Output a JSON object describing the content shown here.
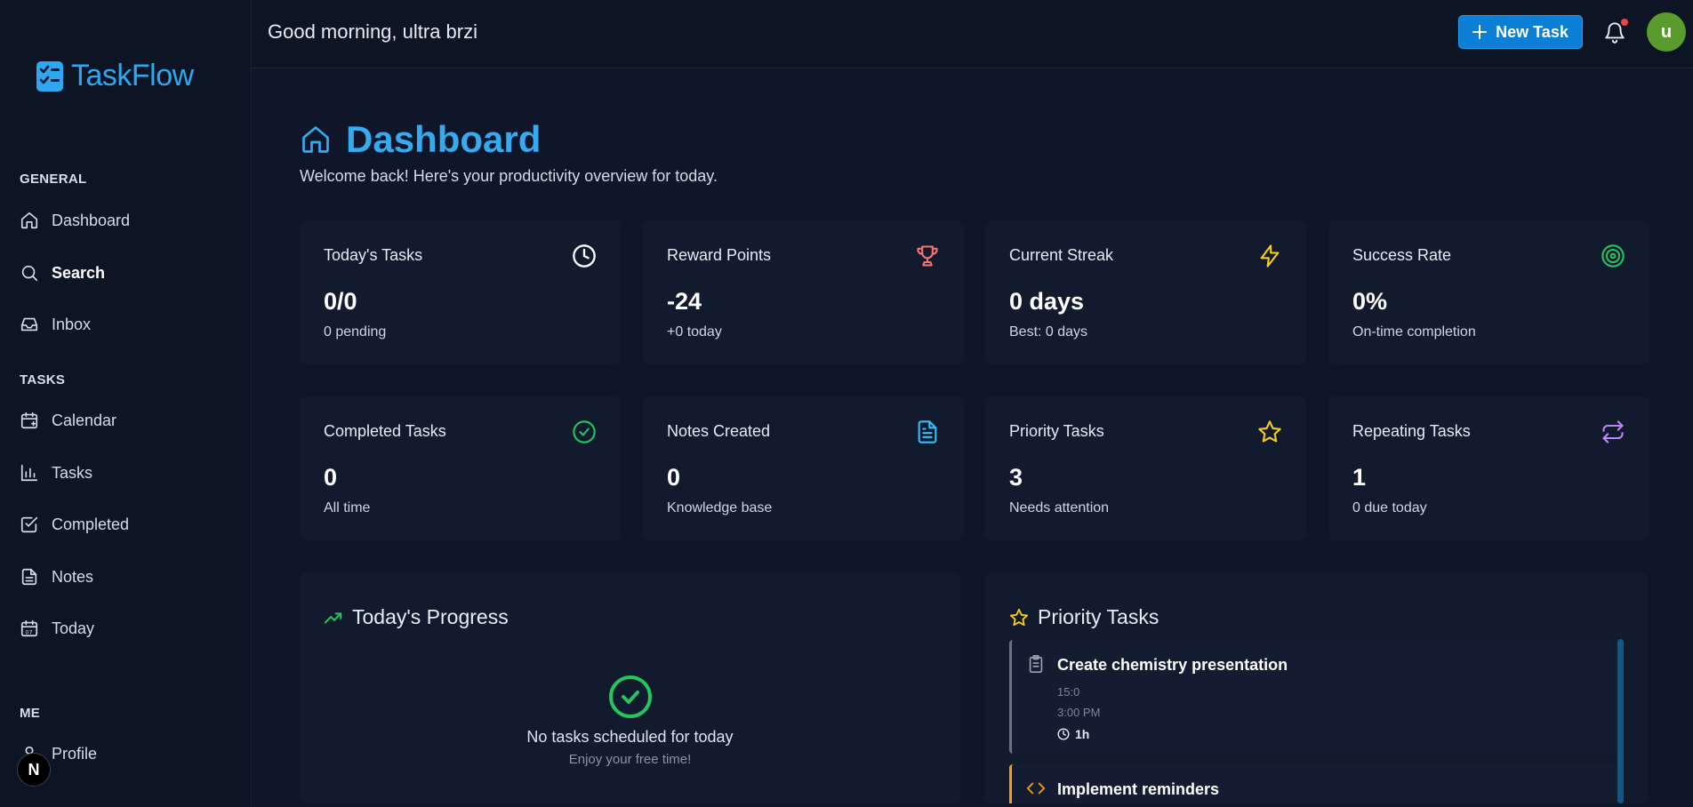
{
  "app": {
    "name": "TaskFlow",
    "accent": "#2ea7f0"
  },
  "header": {
    "greeting": "Good morning, ultra brzi",
    "new_task_label": "New Task",
    "avatar_initial": "u"
  },
  "sidebar": {
    "sections": [
      {
        "title": "GENERAL",
        "items": [
          {
            "label": "Dashboard",
            "icon": "home-icon"
          },
          {
            "label": "Search",
            "icon": "search-icon"
          },
          {
            "label": "Inbox",
            "icon": "inbox-icon"
          }
        ]
      },
      {
        "title": "TASKS",
        "items": [
          {
            "label": "Calendar",
            "icon": "calendar-icon"
          },
          {
            "label": "Tasks",
            "icon": "bar-chart-icon"
          },
          {
            "label": "Completed",
            "icon": "check-square-icon"
          },
          {
            "label": "Notes",
            "icon": "file-text-icon"
          },
          {
            "label": "Today",
            "icon": "calendar-day-icon"
          }
        ]
      },
      {
        "title": "ME",
        "items": [
          {
            "label": "Profile",
            "icon": "user-icon"
          }
        ]
      }
    ],
    "badge": "N"
  },
  "page": {
    "title": "Dashboard",
    "subtitle": "Welcome back! Here's your productivity overview for today."
  },
  "cards": [
    {
      "title": "Today's Tasks",
      "value": "0/0",
      "sub": "0 pending",
      "icon": "clock-icon",
      "color": "#ffffff"
    },
    {
      "title": "Reward Points",
      "value": "-24",
      "sub": "+0 today",
      "icon": "trophy-icon",
      "color": "#f87171"
    },
    {
      "title": "Current Streak",
      "value": "0 days",
      "sub": "Best: 0 days",
      "icon": "lightning-icon",
      "color": "#facc15"
    },
    {
      "title": "Success Rate",
      "value": "0%",
      "sub": "On-time completion",
      "icon": "target-icon",
      "color": "#22c55e"
    },
    {
      "title": "Completed Tasks",
      "value": "0",
      "sub": "All time",
      "icon": "check-circle-icon",
      "color": "#22c55e"
    },
    {
      "title": "Notes Created",
      "value": "0",
      "sub": "Knowledge base",
      "icon": "document-icon",
      "color": "#38bdf8"
    },
    {
      "title": "Priority Tasks",
      "value": "3",
      "sub": "Needs attention",
      "icon": "star-icon",
      "color": "#facc15"
    },
    {
      "title": "Repeating Tasks",
      "value": "1",
      "sub": "0 due today",
      "icon": "repeat-icon",
      "color": "#c084fc"
    }
  ],
  "progress_panel": {
    "title": "Today's Progress",
    "empty_text": "No tasks scheduled for today",
    "empty_sub": "Enjoy your free time!"
  },
  "priority_panel": {
    "title": "Priority Tasks",
    "tasks": [
      {
        "title": "Create chemistry presentation",
        "meta1": "15:0",
        "meta2": "3:00 PM",
        "duration": "1h",
        "icon": "clipboard-icon",
        "border": "#6b7280"
      },
      {
        "title": "Implement reminders",
        "icon": "code-icon",
        "border": "#f59e0b"
      }
    ]
  }
}
